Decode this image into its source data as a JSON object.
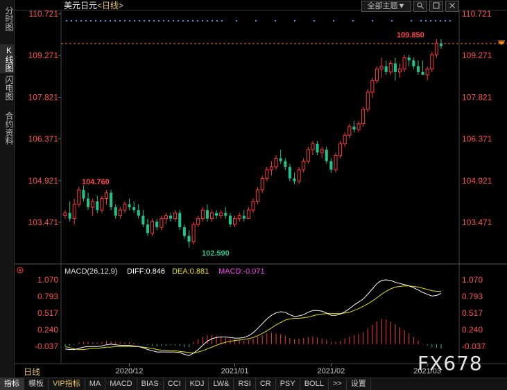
{
  "header": {
    "symbol": "美元日元",
    "period": "<日线>"
  },
  "toolbar": {
    "theme_label": "全部主题▼",
    "search_icon": "search-icon",
    "window_icon": "window-icon",
    "close_icon": "close-icon"
  },
  "sidebar": {
    "tabs": [
      {
        "label": "分时图",
        "active": false
      },
      {
        "label": "K线图",
        "active": true
      },
      {
        "label": "闪电图",
        "active": false
      },
      {
        "label": "合约资料",
        "active": false
      }
    ]
  },
  "price_axis": {
    "ticks": [
      "110.721",
      "109.271",
      "107.821",
      "106.371",
      "104.921",
      "103.471"
    ]
  },
  "annotations": {
    "high_label": "104.760",
    "low_label": "102.590",
    "last_label": "109.850"
  },
  "macd": {
    "settings": "MACD(26,12,9)",
    "diff_label": "DIFF:0.846",
    "dea_label": "DEA:0.881",
    "macd_label": "MACD:-0.071",
    "ticks": [
      "1.070",
      "0.793",
      "0.517",
      "0.240",
      "-0.037"
    ]
  },
  "time_axis": {
    "labels": [
      "2020/12",
      "2021/01",
      "2021/02",
      "2021/03"
    ],
    "period_tab": "日线"
  },
  "bottom_tabs": [
    "指标",
    "模板",
    "VIP指标",
    "MA",
    "MACD",
    "BIAS",
    "CCI",
    "KDJ",
    "LW&",
    "RSI",
    "CR",
    "PSY",
    "BOLL",
    ">>",
    "设置"
  ],
  "watermark": "FX678",
  "colors": {
    "up": "#ff3b3b",
    "down": "#22c28a",
    "diff": "#ffffff",
    "dea": "#e8e000",
    "macd": "#ff40ff",
    "dash": "#ff8c1a",
    "dots": "#3aa0ff"
  },
  "chart_data": {
    "type": "candlestick",
    "price_range": [
      102.9,
      111.0
    ],
    "macd_range": [
      -0.2,
      1.15
    ],
    "x_labels": [
      "2020/12",
      "2021/01",
      "2021/02",
      "2021/03"
    ],
    "candles": [
      [
        103.7,
        103.9,
        103.6,
        103.8
      ],
      [
        103.8,
        104.2,
        103.5,
        103.6
      ],
      [
        103.6,
        104.3,
        103.4,
        104.1
      ],
      [
        104.1,
        104.7,
        104.0,
        104.6
      ],
      [
        104.6,
        104.76,
        104.2,
        104.3
      ],
      [
        104.3,
        104.5,
        103.9,
        104.0
      ],
      [
        104.0,
        104.3,
        103.7,
        104.2
      ],
      [
        104.2,
        104.4,
        103.8,
        103.9
      ],
      [
        103.9,
        104.4,
        103.8,
        104.3
      ],
      [
        104.3,
        104.6,
        104.1,
        104.5
      ],
      [
        104.5,
        104.6,
        103.9,
        104.0
      ],
      [
        104.0,
        104.1,
        103.6,
        103.7
      ],
      [
        103.7,
        104.0,
        103.6,
        103.9
      ],
      [
        103.9,
        104.2,
        103.8,
        104.1
      ],
      [
        104.1,
        104.3,
        103.9,
        104.0
      ],
      [
        104.0,
        104.2,
        103.8,
        103.9
      ],
      [
        103.9,
        104.1,
        103.6,
        103.7
      ],
      [
        103.7,
        103.9,
        103.3,
        103.4
      ],
      [
        103.4,
        103.6,
        103.0,
        103.1
      ],
      [
        103.1,
        103.6,
        103.0,
        103.5
      ],
      [
        103.5,
        103.6,
        103.2,
        103.3
      ],
      [
        103.3,
        103.7,
        103.2,
        103.6
      ],
      [
        103.6,
        103.8,
        103.4,
        103.7
      ],
      [
        103.7,
        103.8,
        103.5,
        103.6
      ],
      [
        103.6,
        103.9,
        103.5,
        103.8
      ],
      [
        103.8,
        103.9,
        103.2,
        103.3
      ],
      [
        103.3,
        103.4,
        102.9,
        103.0
      ],
      [
        103.0,
        103.2,
        102.59,
        102.8
      ],
      [
        102.8,
        103.5,
        102.7,
        103.4
      ],
      [
        103.4,
        103.7,
        103.3,
        103.6
      ],
      [
        103.6,
        104.0,
        103.5,
        103.9
      ],
      [
        103.9,
        104.1,
        103.5,
        103.6
      ],
      [
        103.6,
        103.9,
        103.5,
        103.8
      ],
      [
        103.8,
        103.9,
        103.6,
        103.7
      ],
      [
        103.7,
        103.9,
        103.6,
        103.8
      ],
      [
        103.8,
        104.0,
        103.6,
        103.7
      ],
      [
        103.7,
        103.8,
        103.3,
        103.4
      ],
      [
        103.4,
        103.7,
        103.3,
        103.6
      ],
      [
        103.6,
        103.8,
        103.5,
        103.7
      ],
      [
        103.7,
        103.9,
        103.5,
        103.6
      ],
      [
        103.6,
        104.0,
        103.6,
        103.9
      ],
      [
        103.9,
        104.3,
        103.8,
        104.2
      ],
      [
        104.2,
        104.7,
        104.1,
        104.6
      ],
      [
        104.6,
        105.1,
        104.5,
        105.0
      ],
      [
        105.0,
        105.4,
        104.9,
        105.3
      ],
      [
        105.3,
        105.6,
        105.1,
        105.4
      ],
      [
        105.4,
        105.8,
        105.3,
        105.7
      ],
      [
        105.7,
        106.0,
        105.5,
        105.6
      ],
      [
        105.6,
        105.7,
        105.3,
        105.4
      ],
      [
        105.4,
        105.5,
        104.9,
        105.0
      ],
      [
        105.0,
        105.2,
        104.8,
        104.9
      ],
      [
        104.9,
        105.4,
        104.8,
        105.3
      ],
      [
        105.3,
        105.7,
        105.2,
        105.6
      ],
      [
        105.6,
        106.1,
        105.5,
        106.0
      ],
      [
        106.0,
        106.3,
        105.8,
        106.2
      ],
      [
        106.2,
        106.3,
        105.8,
        105.9
      ],
      [
        105.9,
        106.1,
        105.7,
        106.0
      ],
      [
        106.0,
        106.1,
        105.5,
        105.6
      ],
      [
        105.6,
        105.7,
        105.2,
        105.3
      ],
      [
        105.3,
        105.9,
        105.2,
        105.8
      ],
      [
        105.8,
        106.3,
        105.7,
        106.2
      ],
      [
        106.2,
        106.6,
        106.1,
        106.5
      ],
      [
        106.5,
        106.9,
        106.4,
        106.8
      ],
      [
        106.8,
        107.0,
        106.6,
        106.7
      ],
      [
        106.7,
        107.0,
        106.6,
        106.9
      ],
      [
        106.9,
        107.5,
        106.8,
        107.4
      ],
      [
        107.4,
        108.1,
        107.3,
        108.0
      ],
      [
        108.0,
        108.5,
        107.8,
        108.4
      ],
      [
        108.4,
        108.9,
        108.3,
        108.8
      ],
      [
        108.8,
        109.2,
        108.5,
        108.9
      ],
      [
        108.9,
        109.1,
        108.6,
        108.7
      ],
      [
        108.7,
        109.1,
        108.6,
        109.0
      ],
      [
        109.0,
        109.2,
        108.4,
        108.7
      ],
      [
        108.7,
        109.0,
        108.5,
        108.8
      ],
      [
        108.8,
        109.3,
        108.7,
        109.2
      ],
      [
        109.2,
        109.3,
        108.9,
        109.1
      ],
      [
        109.1,
        109.2,
        108.8,
        108.9
      ],
      [
        108.9,
        109.1,
        108.6,
        108.7
      ],
      [
        108.7,
        109.1,
        108.6,
        108.6
      ],
      [
        108.6,
        108.9,
        108.4,
        108.8
      ],
      [
        108.8,
        109.4,
        108.7,
        109.3
      ],
      [
        109.3,
        109.85,
        109.2,
        109.7
      ],
      [
        109.7,
        109.85,
        109.5,
        109.6
      ]
    ],
    "macd_bars": [
      -0.04,
      -0.03,
      -0.01,
      0.03,
      0.04,
      0.04,
      0.03,
      0.03,
      0.04,
      0.05,
      0.05,
      0.04,
      0.03,
      0.03,
      0.03,
      0.02,
      0.01,
      -0.01,
      -0.02,
      -0.03,
      -0.04,
      -0.03,
      -0.03,
      -0.02,
      -0.02,
      -0.03,
      -0.05,
      -0.05,
      0.04,
      0.08,
      0.12,
      0.15,
      0.15,
      0.14,
      0.12,
      0.11,
      0.09,
      0.08,
      0.07,
      0.06,
      0.07,
      0.09,
      0.12,
      0.15,
      0.18,
      0.19,
      0.18,
      0.17,
      0.14,
      0.1,
      0.08,
      0.09,
      0.1,
      0.12,
      0.13,
      0.11,
      0.09,
      0.07,
      0.04,
      0.04,
      0.06,
      0.09,
      0.12,
      0.15,
      0.17,
      0.2,
      0.26,
      0.32,
      0.38,
      0.42,
      0.41,
      0.38,
      0.33,
      0.28,
      0.23,
      0.18,
      0.12,
      0.06,
      0.01,
      -0.02,
      -0.05,
      -0.06,
      -0.071
    ],
    "diff": [
      -0.08,
      -0.09,
      -0.09,
      -0.07,
      -0.05,
      -0.04,
      -0.04,
      -0.04,
      -0.03,
      -0.01,
      0.0,
      -0.01,
      -0.02,
      -0.02,
      -0.02,
      -0.03,
      -0.04,
      -0.06,
      -0.09,
      -0.11,
      -0.13,
      -0.13,
      -0.13,
      -0.13,
      -0.13,
      -0.14,
      -0.17,
      -0.19,
      -0.15,
      -0.09,
      -0.02,
      0.05,
      0.09,
      0.11,
      0.12,
      0.12,
      0.11,
      0.1,
      0.1,
      0.11,
      0.14,
      0.19,
      0.26,
      0.34,
      0.42,
      0.48,
      0.52,
      0.54,
      0.53,
      0.49,
      0.46,
      0.47,
      0.49,
      0.53,
      0.56,
      0.56,
      0.55,
      0.52,
      0.48,
      0.48,
      0.5,
      0.54,
      0.59,
      0.65,
      0.7,
      0.75,
      0.83,
      0.92,
      1.01,
      1.06,
      1.07,
      1.06,
      1.03,
      1.01,
      0.99,
      0.97,
      0.94,
      0.9,
      0.86,
      0.83,
      0.8,
      0.81,
      0.846
    ],
    "dea": [
      -0.04,
      -0.06,
      -0.08,
      -0.09,
      -0.09,
      -0.08,
      -0.07,
      -0.07,
      -0.06,
      -0.05,
      -0.05,
      -0.04,
      -0.04,
      -0.04,
      -0.04,
      -0.04,
      -0.04,
      -0.05,
      -0.06,
      -0.07,
      -0.09,
      -0.1,
      -0.1,
      -0.11,
      -0.11,
      -0.12,
      -0.13,
      -0.14,
      -0.15,
      -0.13,
      -0.11,
      -0.08,
      -0.05,
      -0.02,
      0.01,
      0.03,
      0.05,
      0.06,
      0.07,
      0.08,
      0.09,
      0.11,
      0.14,
      0.18,
      0.22,
      0.27,
      0.32,
      0.36,
      0.4,
      0.42,
      0.43,
      0.43,
      0.44,
      0.45,
      0.47,
      0.49,
      0.5,
      0.51,
      0.51,
      0.51,
      0.51,
      0.52,
      0.53,
      0.56,
      0.59,
      0.63,
      0.67,
      0.72,
      0.77,
      0.83,
      0.88,
      0.92,
      0.95,
      0.96,
      0.97,
      0.97,
      0.96,
      0.95,
      0.93,
      0.91,
      0.89,
      0.88,
      0.881
    ]
  }
}
